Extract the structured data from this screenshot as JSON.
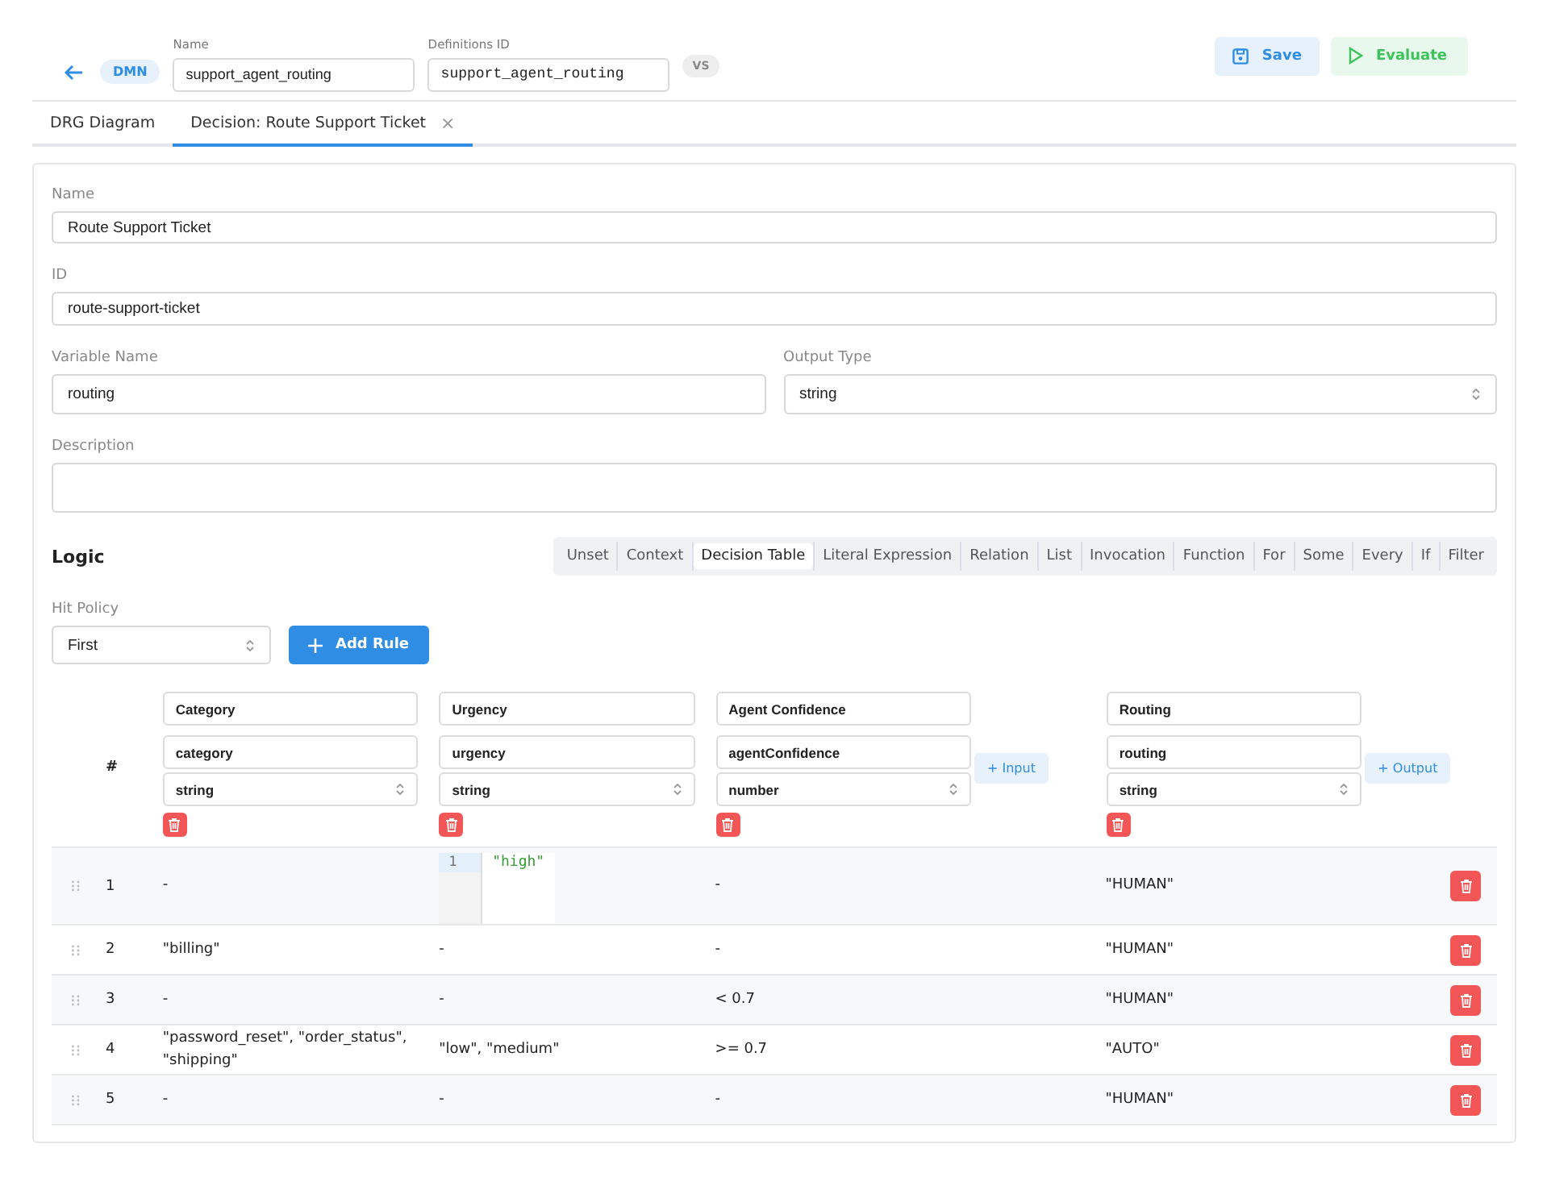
{
  "header": {
    "badge": "DMN",
    "name_label": "Name",
    "name_value": "support_agent_routing",
    "definitions_label": "Definitions ID",
    "definitions_value": "support_agent_routing",
    "version_badge": "VS",
    "buttons": [
      {
        "label": "Save",
        "kind": "save"
      },
      {
        "label": "Evaluate",
        "kind": "evaluate"
      }
    ]
  },
  "tabs": [
    {
      "label": "DRG Diagram",
      "selected": false,
      "closable": false
    },
    {
      "label": "Decision: Route Support Ticket",
      "selected": true,
      "closable": true,
      "close": "×"
    }
  ],
  "form": {
    "name_label": "Name",
    "name_value": "Route Support Ticket",
    "id_label": "ID",
    "id_value": "route-support-ticket",
    "variable_label": "Variable Name",
    "variable_value": "routing",
    "output_type_label": "Output Type",
    "output_type_value": "string",
    "description_label": "Description"
  },
  "logic": {
    "title": "Logic",
    "types": [
      {
        "label": "Unset",
        "selected": false
      },
      {
        "label": "Context",
        "selected": false
      },
      {
        "label": "Decision Table",
        "selected": true
      },
      {
        "label": "Literal Expression",
        "selected": false
      },
      {
        "label": "Relation",
        "selected": false
      },
      {
        "label": "List",
        "selected": false
      },
      {
        "label": "Invocation",
        "selected": false
      },
      {
        "label": "Function",
        "selected": false
      },
      {
        "label": "For",
        "selected": false
      },
      {
        "label": "Some",
        "selected": false
      },
      {
        "label": "Every",
        "selected": false
      },
      {
        "label": "If",
        "selected": false
      },
      {
        "label": "Filter",
        "selected": false
      }
    ]
  },
  "hit_policy": {
    "label": "Hit Policy",
    "value": "First",
    "add_rule": "Add Rule"
  },
  "table": {
    "number_header": "#",
    "add_input": "+ Input",
    "add_output": "+ Output",
    "inputs": [
      {
        "label": "Category",
        "expression": "category",
        "type": "string"
      },
      {
        "label": "Urgency",
        "expression": "urgency",
        "type": "string"
      },
      {
        "label": "Agent Confidence",
        "expression": "agentConfidence",
        "type": "number"
      }
    ],
    "outputs": [
      {
        "label": "Routing",
        "expression": "routing",
        "type": "string"
      }
    ],
    "rows": [
      {
        "number": "1",
        "cells": [
          {
            "kind": "text",
            "text": "-"
          },
          {
            "kind": "editor",
            "line": "1",
            "text": "\"high\""
          },
          {
            "kind": "text",
            "text": "-"
          },
          {
            "kind": "text",
            "text": "\"HUMAN\""
          }
        ]
      },
      {
        "number": "2",
        "cells": [
          {
            "kind": "text",
            "text": "\"billing\""
          },
          {
            "kind": "text",
            "text": "-"
          },
          {
            "kind": "text",
            "text": "-"
          },
          {
            "kind": "text",
            "text": "\"HUMAN\""
          }
        ]
      },
      {
        "number": "3",
        "cells": [
          {
            "kind": "text",
            "text": "-"
          },
          {
            "kind": "text",
            "text": "-"
          },
          {
            "kind": "text",
            "text": "< 0.7"
          },
          {
            "kind": "text",
            "text": "\"HUMAN\""
          }
        ]
      },
      {
        "number": "4",
        "cells": [
          {
            "kind": "text",
            "text": "\"password_reset\", \"order_status\", \"shipping\""
          },
          {
            "kind": "text",
            "text": "\"low\", \"medium\""
          },
          {
            "kind": "text",
            "text": ">= 0.7"
          },
          {
            "kind": "text",
            "text": "\"AUTO\""
          }
        ]
      },
      {
        "number": "5",
        "cells": [
          {
            "kind": "text",
            "text": "-"
          },
          {
            "kind": "text",
            "text": "-"
          },
          {
            "kind": "text",
            "text": "-"
          },
          {
            "kind": "text",
            "text": "\"HUMAN\""
          }
        ]
      }
    ]
  }
}
